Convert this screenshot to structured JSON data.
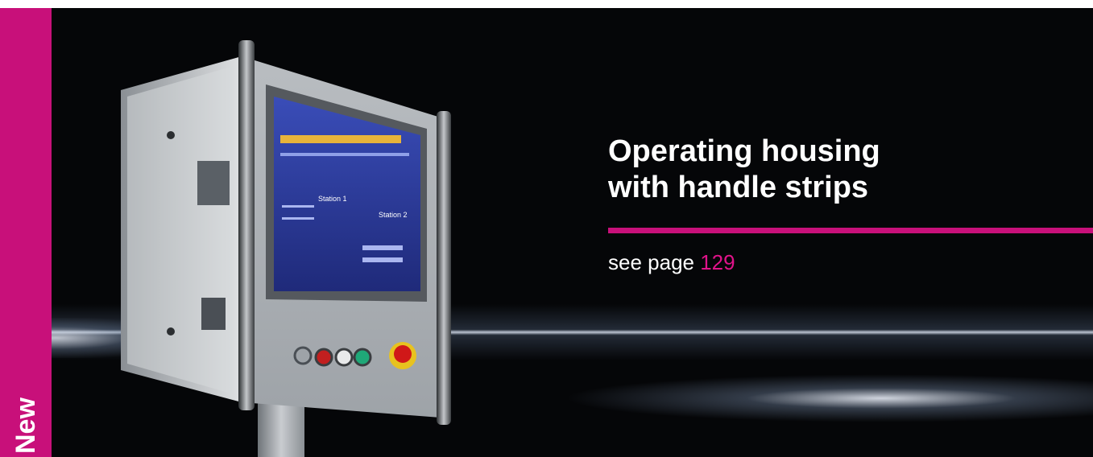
{
  "badge": {
    "label": "New"
  },
  "headline": {
    "line1": "Operating housing",
    "line2": "with handle strips"
  },
  "reference": {
    "prefix": "see page",
    "page": "129"
  },
  "screen": {
    "station1": "Station 1",
    "station2": "Station 2"
  },
  "colors": {
    "accent": "#c8107a",
    "page_number": "#e0138a",
    "background": "#050608",
    "text": "#ffffff"
  }
}
